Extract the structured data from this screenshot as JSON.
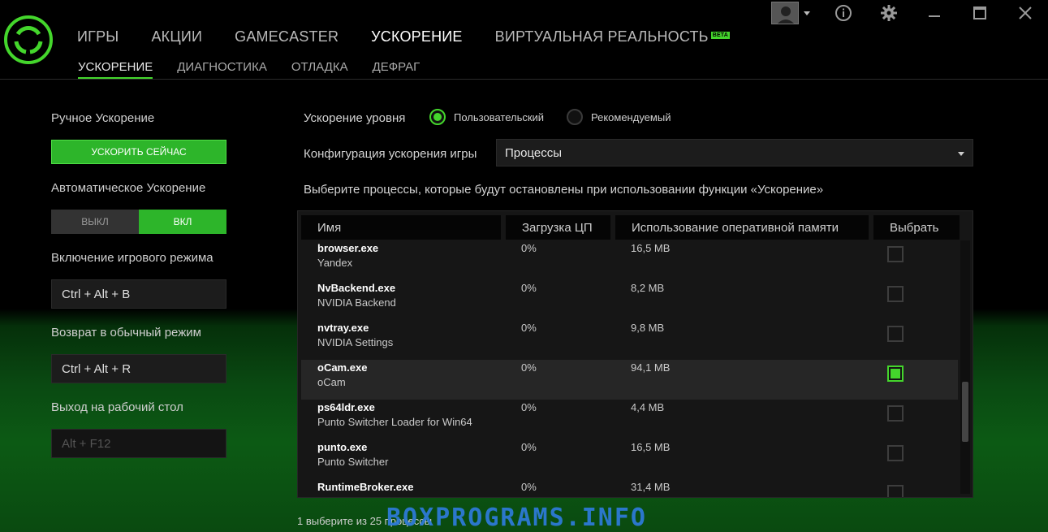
{
  "header": {
    "main_nav": [
      "ИГРЫ",
      "АКЦИИ",
      "GAMECASTER",
      "УСКОРЕНИЕ",
      "ВИРТУАЛЬНАЯ РЕАЛЬНОСТЬ"
    ],
    "beta": "BETA",
    "sub_nav": [
      "УСКОРЕНИЕ",
      "ДИАГНОСТИКА",
      "ОТЛАДКА",
      "ДЕФРАГ"
    ],
    "accent": "#44d62c"
  },
  "left": {
    "manual_label": "Ручное Ускорение",
    "boost_button": "УСКОРИТЬ СЕЙЧАС",
    "auto_label": "Автоматическое Ускорение",
    "toggle_off": "ВЫКЛ",
    "toggle_on": "ВКЛ",
    "game_mode_label": "Включение игрового режима",
    "game_mode_hotkey": "Ctrl + Alt + B",
    "normal_mode_label": "Возврат в обычный режим",
    "normal_mode_hotkey": "Ctrl + Alt + R",
    "desktop_label": "Выход на рабочий стол",
    "desktop_hotkey": "Alt + F12"
  },
  "right": {
    "level_label": "Ускорение уровня",
    "radio_custom": "Пользовательский",
    "radio_recommended": "Рекомендуемый",
    "config_label": "Конфигурация ускорения игры",
    "config_value": "Процессы",
    "instruction": "Выберите процессы, которые будут остановлены при использовании функции «Ускорение»"
  },
  "table": {
    "headers": [
      "Имя",
      "Загрузка ЦП",
      "Использование оперативной памяти",
      "Выбрать"
    ],
    "rows": [
      {
        "name": "browser.exe",
        "desc": "Yandex",
        "cpu": "0%",
        "mem": "16,5 MB",
        "checked": false
      },
      {
        "name": "NvBackend.exe",
        "desc": "NVIDIA Backend",
        "cpu": "0%",
        "mem": "8,2 MB",
        "checked": false
      },
      {
        "name": "nvtray.exe",
        "desc": "NVIDIA Settings",
        "cpu": "0%",
        "mem": "9,8 MB",
        "checked": false
      },
      {
        "name": "oCam.exe",
        "desc": "oCam",
        "cpu": "0%",
        "mem": "94,1 MB",
        "checked": true
      },
      {
        "name": "ps64ldr.exe",
        "desc": "Punto Switcher Loader for Win64",
        "cpu": "0%",
        "mem": "4,4 MB",
        "checked": false
      },
      {
        "name": "punto.exe",
        "desc": "Punto Switcher",
        "cpu": "0%",
        "mem": "16,5 MB",
        "checked": false
      },
      {
        "name": "RuntimeBroker.exe",
        "desc": "",
        "cpu": "0%",
        "mem": "31,4 MB",
        "checked": false
      }
    ]
  },
  "footer": {
    "count": "1 выберите из 25 процессы"
  },
  "watermark": "BOXPROGRAMS.INFO",
  "icons": {
    "logo": "razer-cortex-logo",
    "avatar": "user-avatar-icon",
    "info": "info-icon",
    "settings": "gear-icon",
    "minimize": "minimize-icon",
    "maximize": "maximize-icon",
    "close": "close-icon"
  }
}
